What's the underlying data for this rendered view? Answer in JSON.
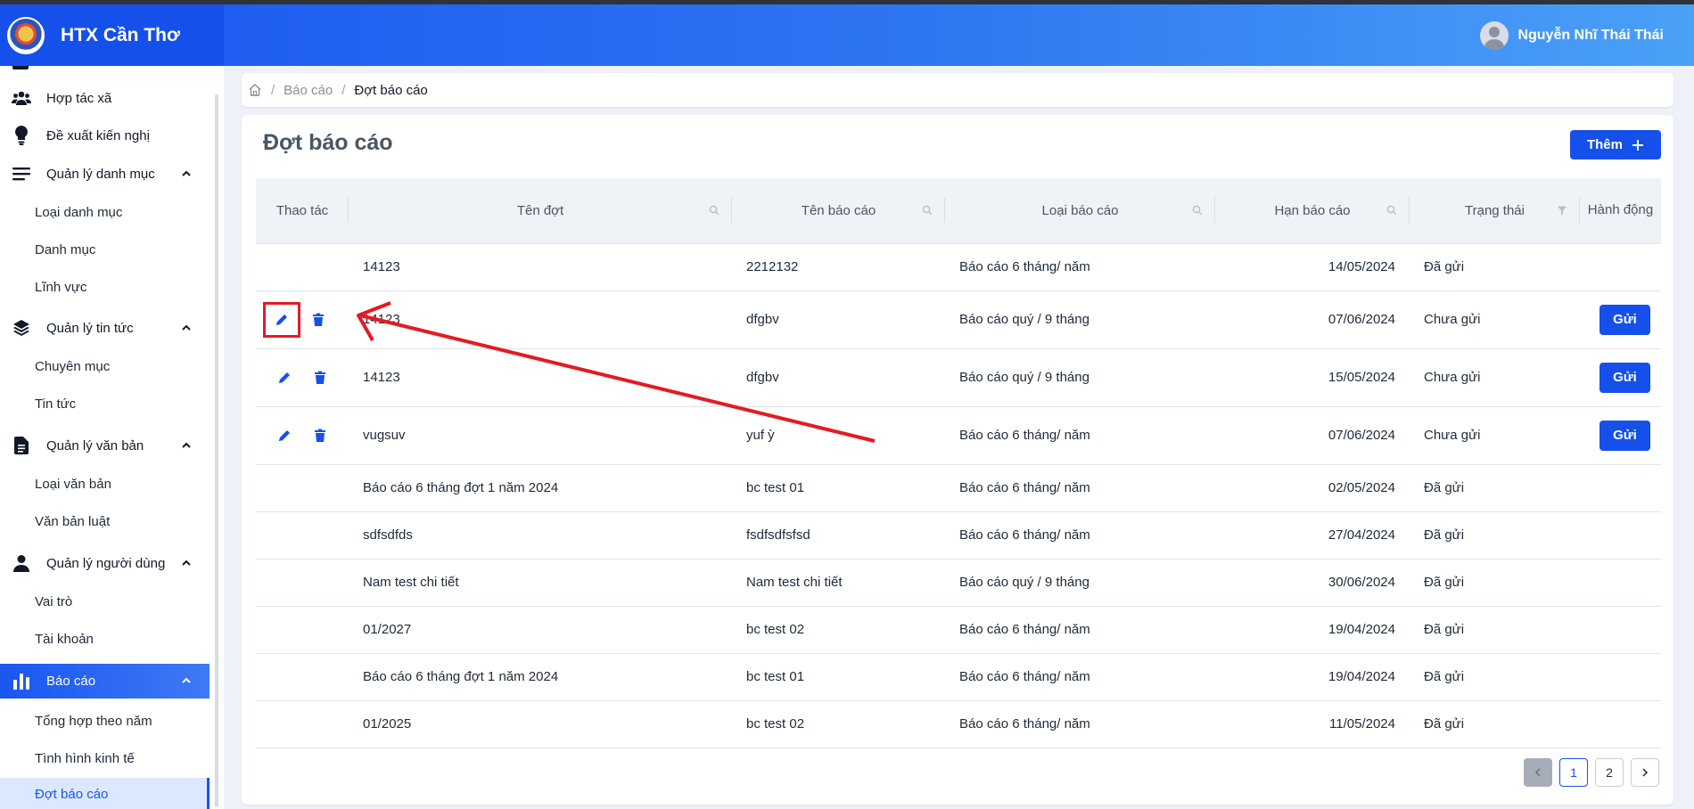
{
  "app": {
    "title": "HTX Cần Thơ",
    "user_name": "Nguyễn Nhĩ Thái Thái"
  },
  "sidebar": {
    "items": [
      {
        "label": "Hợp tác xã",
        "icon": "users-icon"
      },
      {
        "label": "Đề xuất kiến nghị",
        "icon": "lightbulb-icon"
      },
      {
        "label": "Quản lý danh mục",
        "icon": "list-icon"
      },
      {
        "label": "Loại danh mục"
      },
      {
        "label": "Danh mục"
      },
      {
        "label": "Lĩnh vực"
      },
      {
        "label": "Quản lý tin tức",
        "icon": "layers-icon"
      },
      {
        "label": "Chuyên mục"
      },
      {
        "label": "Tin tức"
      },
      {
        "label": "Quản lý văn bản",
        "icon": "document-icon"
      },
      {
        "label": "Loại văn bản"
      },
      {
        "label": "Văn bản luật"
      },
      {
        "label": "Quản lý người dùng",
        "icon": "user-icon"
      },
      {
        "label": "Vai trò"
      },
      {
        "label": "Tài khoản"
      },
      {
        "label": "Báo cáo",
        "icon": "bar-chart-icon"
      },
      {
        "label": "Tổng hợp theo năm"
      },
      {
        "label": "Tình hình kinh tế"
      },
      {
        "label": "Đợt báo cáo"
      }
    ]
  },
  "breadcrumb": {
    "level1": "Báo cáo",
    "current": "Đợt báo cáo"
  },
  "page": {
    "title": "Đợt báo cáo",
    "add_label": "Thêm"
  },
  "table": {
    "headers": [
      "Thao tác",
      "Tên đợt",
      "Tên báo cáo",
      "Loại báo cáo",
      "Hạn báo cáo",
      "Trạng thái",
      "Hành động"
    ],
    "send_label": "Gửi",
    "rows": [
      {
        "ten_dot": "14123",
        "ten_bao_cao": "2212132",
        "loai": "Báo cáo 6 tháng/ năm",
        "han": "14/05/2024",
        "trang_thai": "Đã gửi",
        "actions": false
      },
      {
        "ten_dot": "14123",
        "ten_bao_cao": "dfgbv",
        "loai": "Báo cáo quý / 9 tháng",
        "han": "07/06/2024",
        "trang_thai": "Chưa gửi",
        "actions": true
      },
      {
        "ten_dot": "14123",
        "ten_bao_cao": "dfgbv",
        "loai": "Báo cáo quý / 9 tháng",
        "han": "15/05/2024",
        "trang_thai": "Chưa gửi",
        "actions": true
      },
      {
        "ten_dot": "vugsuv",
        "ten_bao_cao": "yuf ỳ",
        "loai": "Báo cáo 6 tháng/ năm",
        "han": "07/06/2024",
        "trang_thai": "Chưa gửi",
        "actions": true
      },
      {
        "ten_dot": "Báo cáo 6 tháng đợt 1 năm 2024",
        "ten_bao_cao": "bc test 01",
        "loai": "Báo cáo 6 tháng/ năm",
        "han": "02/05/2024",
        "trang_thai": "Đã gửi",
        "actions": false
      },
      {
        "ten_dot": "sdfsdfds",
        "ten_bao_cao": "fsdfsdfsfsd",
        "loai": "Báo cáo 6 tháng/ năm",
        "han": "27/04/2024",
        "trang_thai": "Đã gửi",
        "actions": false
      },
      {
        "ten_dot": "Nam test chi tiết",
        "ten_bao_cao": "Nam test chi tiết",
        "loai": "Báo cáo quý / 9 tháng",
        "han": "30/06/2024",
        "trang_thai": "Đã gửi",
        "actions": false
      },
      {
        "ten_dot": "01/2027",
        "ten_bao_cao": "bc test 02",
        "loai": "Báo cáo 6 tháng/ năm",
        "han": "19/04/2024",
        "trang_thai": "Đã gửi",
        "actions": false
      },
      {
        "ten_dot": "Báo cáo 6 tháng đợt 1 năm 2024",
        "ten_bao_cao": "bc test 01",
        "loai": "Báo cáo 6 tháng/ năm",
        "han": "19/04/2024",
        "trang_thai": "Đã gửi",
        "actions": false
      },
      {
        "ten_dot": "01/2025",
        "ten_bao_cao": "bc test 02",
        "loai": "Báo cáo 6 tháng/ năm",
        "han": "11/05/2024",
        "trang_thai": "Đã gửi",
        "actions": false
      }
    ]
  },
  "pagination": {
    "pages": [
      "1",
      "2"
    ],
    "current": "1"
  },
  "colors": {
    "primary": "#1550ea",
    "annotation": "#e31b23"
  }
}
